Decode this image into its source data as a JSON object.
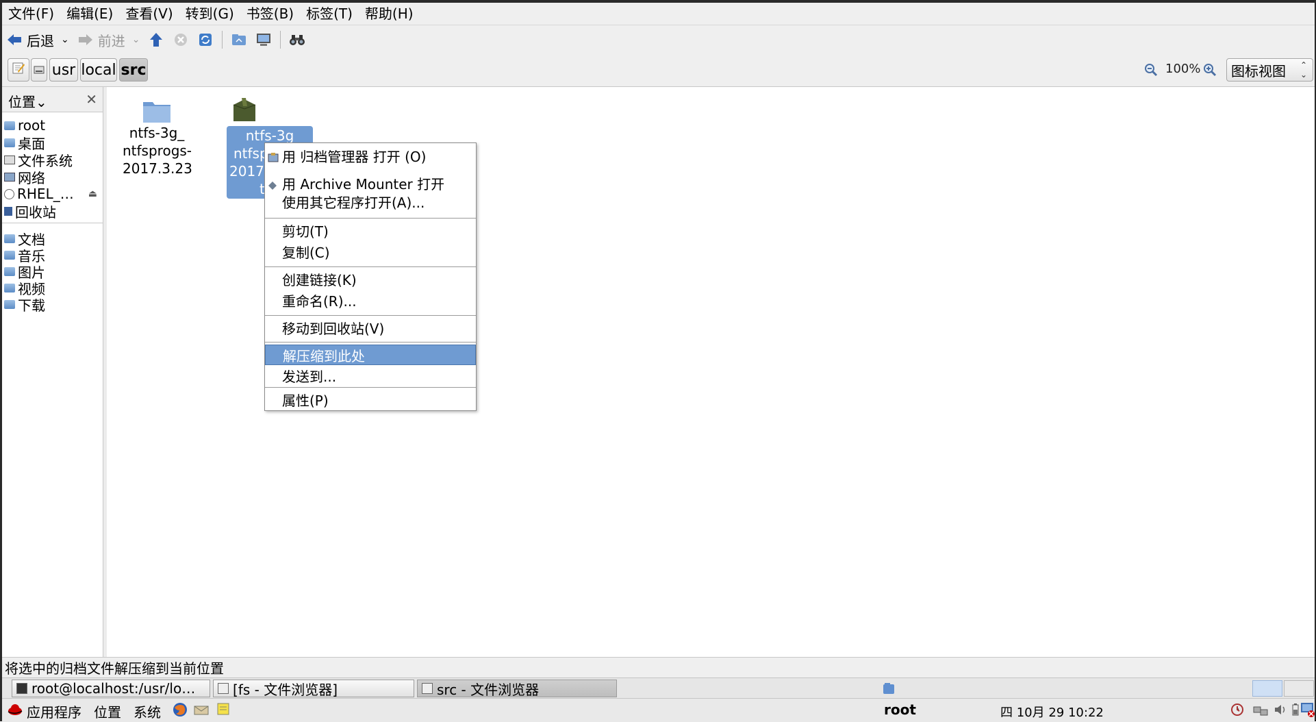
{
  "menubar": [
    "文件(F)",
    "编辑(E)",
    "查看(V)",
    "转到(G)",
    "书签(B)",
    "标签(T)",
    "帮助(H)"
  ],
  "toolbar": {
    "back_label": "后退",
    "forward_label": "前进"
  },
  "path": [
    "usr",
    "local",
    "src"
  ],
  "zoom": "100%",
  "view_mode": "图标视图",
  "sidebar": {
    "header": "位置",
    "close_glyph": "✕",
    "places": [
      "root",
      "桌面",
      "文件系统",
      "网络",
      "RHEL_…",
      "回收站"
    ],
    "bookmarks": [
      "文档",
      "音乐",
      "图片",
      "视频",
      "下载"
    ]
  },
  "files": [
    {
      "lines": [
        "ntfs-3g_",
        "ntfsprogs-",
        "2017.3.23"
      ]
    },
    {
      "lines": [
        "ntfs-3g",
        "ntfsp",
        "2017",
        "t"
      ]
    }
  ],
  "context_menu": [
    "用 归档管理器 打开 (O)",
    "用 Archive Mounter 打开",
    "使用其它程序打开(A)...",
    "剪切(T)",
    "复制(C)",
    "创建链接(K)",
    "重命名(R)...",
    "移动到回收站(V)",
    "解压缩到此处",
    "发送到...",
    "属性(P)"
  ],
  "statusbar": "将选中的归档文件解压缩到当前位置",
  "taskbar": [
    "root@localhost:/usr/lo…",
    "[fs - 文件浏览器]",
    "src - 文件浏览器"
  ],
  "panel": {
    "apps": "应用程序",
    "places": "位置",
    "system": "系统",
    "user": "root",
    "datetime": "四 10月 29 10:22"
  },
  "colors": {
    "selection": "#6f9bd2",
    "chrome": "#efefef"
  }
}
